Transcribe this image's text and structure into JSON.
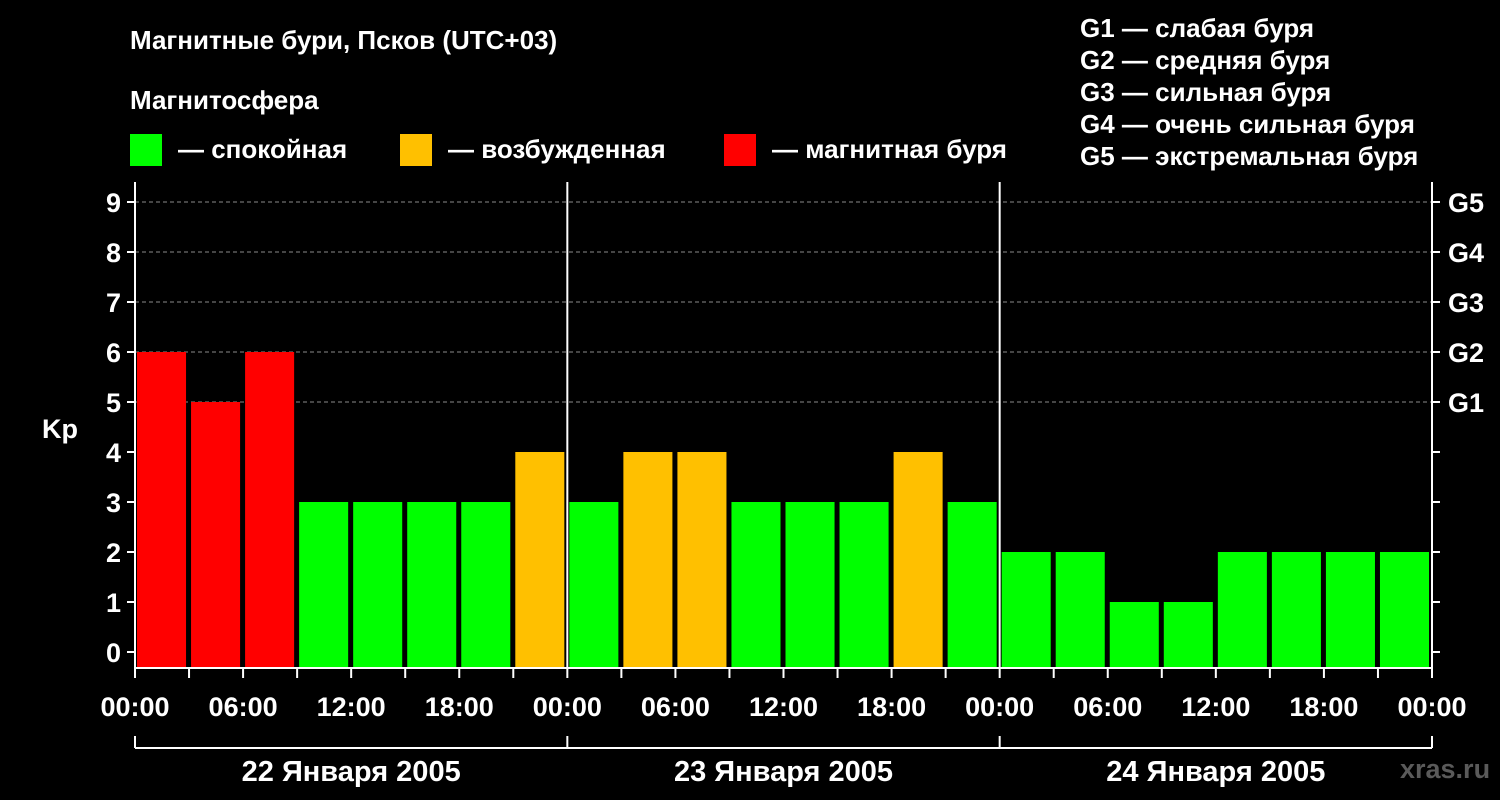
{
  "chart_data": {
    "type": "bar",
    "title": "Магнитные бури, Псков (UTC+03)",
    "subtitle": "Магнитосфера",
    "legend": [
      {
        "label": "— спокойная",
        "color": "#00ff00"
      },
      {
        "label": "— возбужденная",
        "color": "#ffc000"
      },
      {
        "label": "— магнитная буря",
        "color": "#ff0000"
      }
    ],
    "g_scale_legend": [
      "G1 — слабая буря",
      "G2 — средняя буря",
      "G3 — сильная буря",
      "G4 — очень сильная буря",
      "G5 — экстремальная буря"
    ],
    "ylabel": "Kp",
    "ylim": [
      0,
      9
    ],
    "y_ticks": [
      "0",
      "1",
      "2",
      "3",
      "4",
      "5",
      "6",
      "7",
      "8",
      "9"
    ],
    "y2_ticks": [
      {
        "value": 5,
        "label": "G1"
      },
      {
        "value": 6,
        "label": "G2"
      },
      {
        "value": 7,
        "label": "G3"
      },
      {
        "value": 8,
        "label": "G4"
      },
      {
        "value": 9,
        "label": "G5"
      }
    ],
    "x_tick_labels": [
      "00:00",
      "06:00",
      "12:00",
      "18:00",
      "00:00",
      "06:00",
      "12:00",
      "18:00",
      "00:00",
      "06:00",
      "12:00",
      "18:00",
      "00:00"
    ],
    "days": [
      "22 Января 2005",
      "23 Января 2005",
      "24 Января 2005"
    ],
    "values": [
      6,
      5,
      6,
      3,
      3,
      3,
      3,
      4,
      3,
      4,
      4,
      3,
      3,
      3,
      4,
      3,
      2,
      2,
      1,
      1,
      2,
      2,
      2,
      2
    ],
    "colors": {
      "quiet": "#00ff00",
      "active": "#ffc000",
      "storm": "#ff0000"
    },
    "grid": "dashed at Kp 5–9",
    "watermark": "xras.ru"
  }
}
